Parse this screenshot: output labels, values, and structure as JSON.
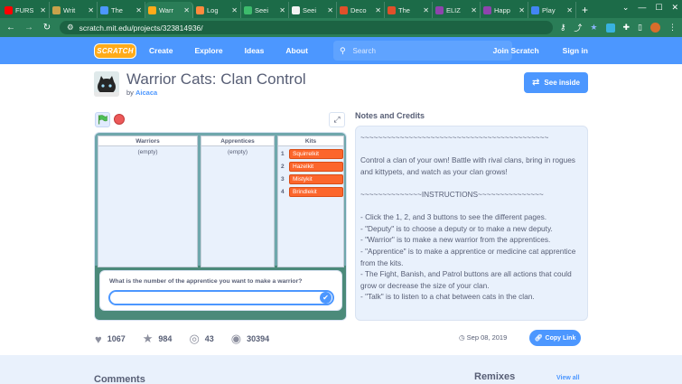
{
  "browser": {
    "tabs": [
      {
        "label": "FURS",
        "color": "#ff0000"
      },
      {
        "label": "Writ",
        "color": "#c8a24b"
      },
      {
        "label": "The",
        "color": "#4c97ff"
      },
      {
        "label": "Warr",
        "color": "#ffab19"
      },
      {
        "label": "Log",
        "color": "#ff8a3d"
      },
      {
        "label": "Seei",
        "color": "#3dbb6c"
      },
      {
        "label": "Seei",
        "color": "#f2f2f2"
      },
      {
        "label": "Deco",
        "color": "#e0502a"
      },
      {
        "label": "The",
        "color": "#e0502a"
      },
      {
        "label": "ELIZ",
        "color": "#8e44ad"
      },
      {
        "label": "Happ",
        "color": "#8e44ad"
      },
      {
        "label": "Play",
        "color": "#4285f4"
      }
    ],
    "url": "scratch.mit.edu/projects/323814936/"
  },
  "nav": {
    "logo": "SCRATCH",
    "create": "Create",
    "explore": "Explore",
    "ideas": "Ideas",
    "about": "About",
    "search_placeholder": "Search",
    "join": "Join Scratch",
    "sign_in": "Sign in"
  },
  "project": {
    "title": "Warrior Cats: Clan Control",
    "by_label": "by",
    "author": "Aicaca",
    "see_inside": "See inside"
  },
  "stage": {
    "lists": [
      {
        "header": "Warriors",
        "empty": "(empty)"
      },
      {
        "header": "Apprentices",
        "empty": "(empty)"
      },
      {
        "header": "Kits",
        "items": [
          "Squirrelkit",
          "Hazelkit",
          "Mistykit",
          "Brindlekit"
        ]
      }
    ],
    "question": "What is the number of the apprentice you want to make a warrior?"
  },
  "stats": {
    "loves": "1067",
    "favorites": "984",
    "remixes": "43",
    "views": "30394",
    "shared_date": "Sep 08, 2019",
    "copy_link": "Copy Link"
  },
  "notes": {
    "title": "Notes and Credits",
    "text": "~~~~~~~~~~~~~~~~~~~~~~~~~~~~~~~~~~~~~~~~~~~\n\nControl a clan of your own! Battle with rival clans, bring in rogues and kittypets, and watch as your clan grows!\n\n~~~~~~~~~~~~~~INSTRUCTIONS~~~~~~~~~~~~~~~\n\n- Click the 1, 2, and 3 buttons to see the different pages.\n- \"Deputy\" is to choose a deputy or to make a new deputy.\n- \"Warrior\" is to make a new warrior from the apprentices.\n- \"Apprentice\" is to make a apprentice or medicine cat apprentice from the kits.\n- The Fight, Banish, and Patrol buttons are all actions that could grow or decrease the size of your clan.\n- \"Talk\" is to listen to a chat between cats in the clan."
  },
  "bottom": {
    "comments": "Comments",
    "remixes": "Remixes",
    "view_all": "View all"
  }
}
